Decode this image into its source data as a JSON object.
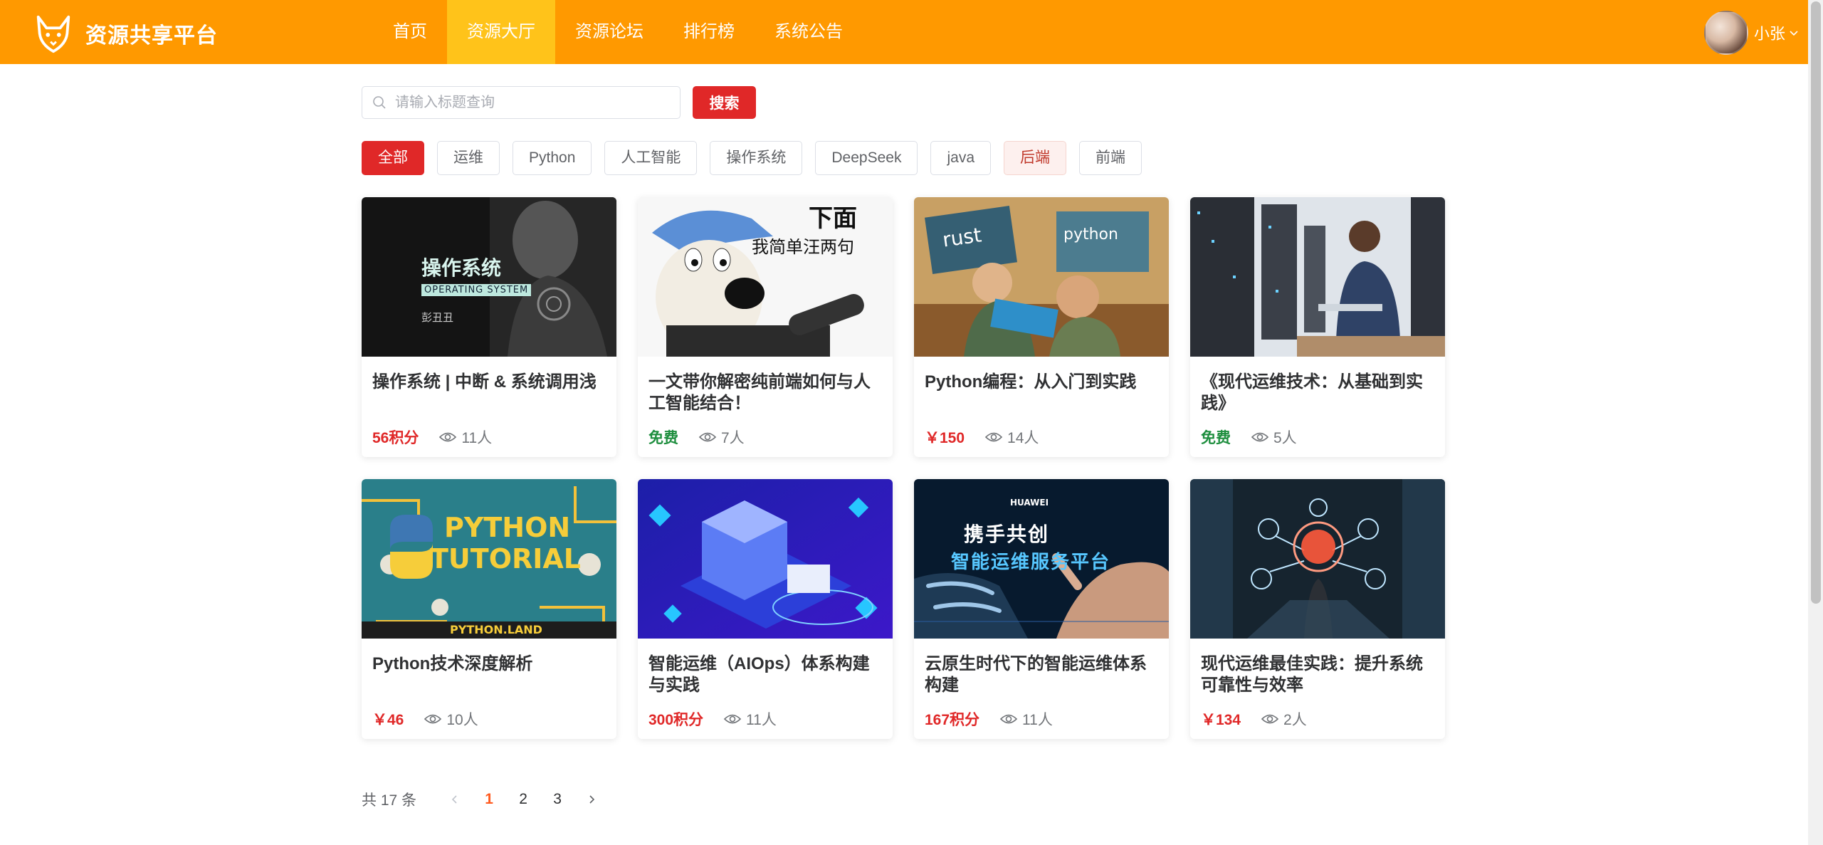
{
  "header": {
    "app_title": "资源共享平台",
    "nav": [
      {
        "label": "首页",
        "active": false
      },
      {
        "label": "资源大厅",
        "active": true
      },
      {
        "label": "资源论坛",
        "active": false
      },
      {
        "label": "排行榜",
        "active": false
      },
      {
        "label": "系统公告",
        "active": false
      }
    ],
    "user_name": "小张",
    "brand_color": "#ff9900",
    "active_nav_color": "#ffc31a"
  },
  "search": {
    "placeholder": "请输入标题查询",
    "value": "",
    "button_label": "搜索"
  },
  "tags": [
    {
      "label": "全部",
      "active": true
    },
    {
      "label": "运维"
    },
    {
      "label": "Python"
    },
    {
      "label": "人工智能"
    },
    {
      "label": "操作系统"
    },
    {
      "label": "DeepSeek"
    },
    {
      "label": "java"
    },
    {
      "label": "后端"
    },
    {
      "label": "前端"
    }
  ],
  "cards": [
    {
      "title": "操作系统 | 中断 & 系统调用浅",
      "price": "56积分",
      "price_type": "points",
      "views": "11人",
      "thumb": "os-book-cover",
      "thumb_text": [
        "操作系统",
        "OPERATING SYSTEM",
        "彭丑丑"
      ]
    },
    {
      "title": "一文带你解密纯前端如何与人工智能结合！",
      "price": "免费",
      "price_type": "free",
      "views": "7人",
      "thumb": "cartoon-dog-microphone",
      "thumb_text": [
        "下面",
        "我简单汪两句"
      ]
    },
    {
      "title": "Python编程：从入门到实践",
      "price": "￥150",
      "price_type": "money",
      "views": "14人",
      "thumb": "rust-python-illustration",
      "thumb_text": [
        "rust",
        "python"
      ]
    },
    {
      "title": "《现代运维技术：从基础到实践》",
      "price": "免费",
      "price_type": "free",
      "views": "5人",
      "thumb": "server-room-engineer",
      "thumb_text": []
    },
    {
      "title": "Python技术深度解析",
      "price": "￥46",
      "price_type": "money",
      "views": "10人",
      "thumb": "python-tutorial-banner",
      "thumb_text": [
        "PYTHON",
        "TUTORIAL",
        "PYTHON.LAND"
      ]
    },
    {
      "title": "智能运维（AIOps）体系构建与实践",
      "price": "300积分",
      "price_type": "points",
      "views": "11人",
      "thumb": "isometric-datacenter",
      "thumb_text": []
    },
    {
      "title": "云原生时代下的智能运维体系构建",
      "price": "167积分",
      "price_type": "points",
      "views": "11人",
      "thumb": "huawei-robot-hand",
      "thumb_text": [
        "HUAWEI",
        "携手共创",
        "智能运维服务平台"
      ]
    },
    {
      "title": "现代运维最佳实践：提升系统可靠性与效率",
      "price": "￥134",
      "price_type": "money",
      "views": "2人",
      "thumb": "cyber-security-figure",
      "thumb_text": []
    }
  ],
  "pagination": {
    "total_label": "共 17 条",
    "pages": [
      "1",
      "2",
      "3"
    ],
    "current": "1"
  },
  "icons": {
    "logo": "fox-logo-icon",
    "search": "search-icon",
    "views": "eye-icon",
    "user_menu": "chevron-down-icon",
    "prev": "chevron-left-icon",
    "next": "chevron-right-icon"
  },
  "colors": {
    "accent_red": "#e02828",
    "free_green": "#1e8e3e",
    "page_active": "#ff5a1f"
  }
}
